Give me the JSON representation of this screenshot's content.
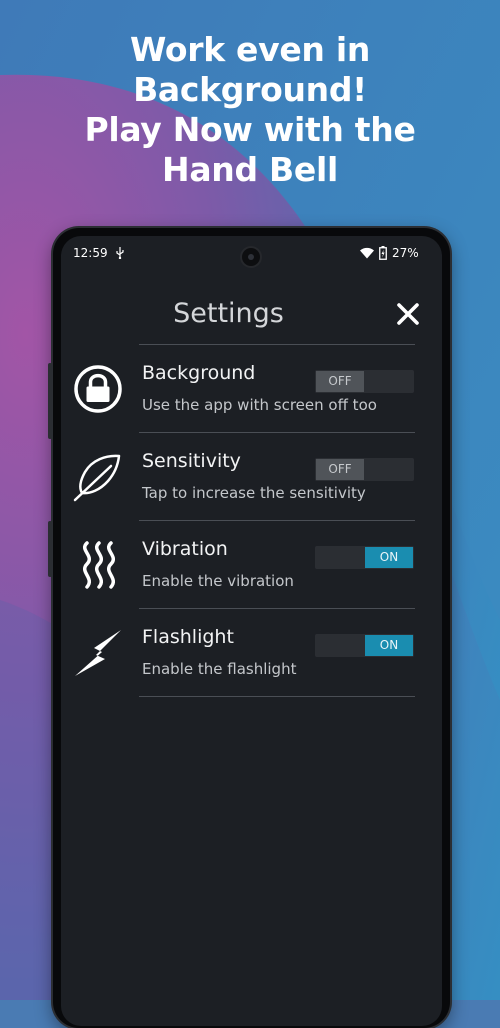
{
  "promo": {
    "line1": "Work even in",
    "line2": "Background!",
    "line3": "Play Now with the",
    "line4": "Hand Bell"
  },
  "status_bar": {
    "time": "12:59",
    "battery": "27%",
    "icons": [
      "usb-icon",
      "wifi-icon",
      "battery-icon"
    ]
  },
  "settings": {
    "title": "Settings",
    "close_icon": "close-icon",
    "items": [
      {
        "title": "Background",
        "subtitle": "Use the app with screen off too",
        "icon": "lock-icon",
        "toggle_label": "OFF",
        "state": "off"
      },
      {
        "title": "Sensitivity",
        "subtitle": "Tap to increase the sensitivity",
        "icon": "feather-icon",
        "toggle_label": "OFF",
        "state": "off"
      },
      {
        "title": "Vibration",
        "subtitle": "Enable the vibration",
        "icon": "vibration-icon",
        "toggle_label": "ON",
        "state": "on"
      },
      {
        "title": "Flashlight",
        "subtitle": "Enable the flashlight",
        "icon": "lightning-icon",
        "toggle_label": "ON",
        "state": "on"
      }
    ]
  },
  "colors": {
    "toggle_on": "#1a8db0",
    "toggle_off": "#505459",
    "screen_bg": "#1c1f24"
  }
}
